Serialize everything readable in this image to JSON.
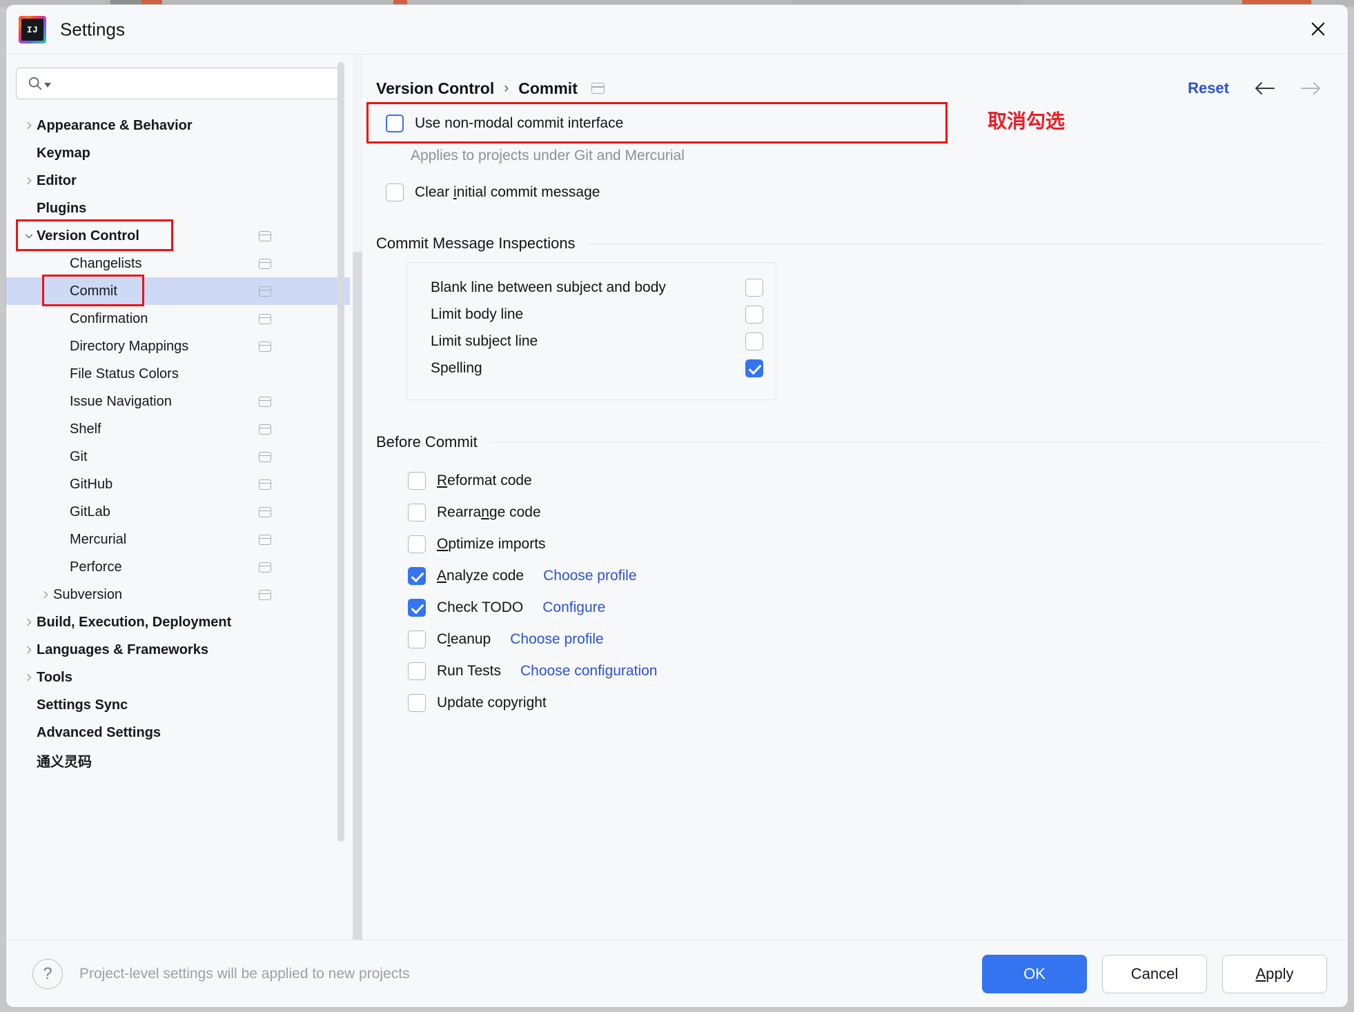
{
  "window": {
    "title": "Settings",
    "logo_text": "IJ",
    "close_icon": "close-icon"
  },
  "search": {
    "value": "",
    "placeholder": ""
  },
  "sidebar": {
    "items": [
      {
        "label": "Appearance & Behavior",
        "level": 1,
        "bold": true,
        "arrow": "right",
        "selected": false,
        "project_icon": false
      },
      {
        "label": "Keymap",
        "level": 1,
        "bold": true,
        "arrow": "none",
        "selected": false,
        "project_icon": false
      },
      {
        "label": "Editor",
        "level": 1,
        "bold": true,
        "arrow": "right",
        "selected": false,
        "project_icon": false
      },
      {
        "label": "Plugins",
        "level": 1,
        "bold": true,
        "arrow": "none",
        "selected": false,
        "project_icon": false
      },
      {
        "label": "Version Control",
        "level": 1,
        "bold": true,
        "arrow": "down",
        "selected": false,
        "project_icon": true
      },
      {
        "label": "Changelists",
        "level": 2,
        "bold": false,
        "arrow": "none",
        "selected": false,
        "project_icon": true
      },
      {
        "label": "Commit",
        "level": 2,
        "bold": false,
        "arrow": "none",
        "selected": true,
        "project_icon": true
      },
      {
        "label": "Confirmation",
        "level": 2,
        "bold": false,
        "arrow": "none",
        "selected": false,
        "project_icon": true
      },
      {
        "label": "Directory Mappings",
        "level": 2,
        "bold": false,
        "arrow": "none",
        "selected": false,
        "project_icon": true
      },
      {
        "label": "File Status Colors",
        "level": 2,
        "bold": false,
        "arrow": "none",
        "selected": false,
        "project_icon": false
      },
      {
        "label": "Issue Navigation",
        "level": 2,
        "bold": false,
        "arrow": "none",
        "selected": false,
        "project_icon": true
      },
      {
        "label": "Shelf",
        "level": 2,
        "bold": false,
        "arrow": "none",
        "selected": false,
        "project_icon": true
      },
      {
        "label": "Git",
        "level": 2,
        "bold": false,
        "arrow": "none",
        "selected": false,
        "project_icon": true
      },
      {
        "label": "GitHub",
        "level": 2,
        "bold": false,
        "arrow": "none",
        "selected": false,
        "project_icon": true
      },
      {
        "label": "GitLab",
        "level": 2,
        "bold": false,
        "arrow": "none",
        "selected": false,
        "project_icon": true
      },
      {
        "label": "Mercurial",
        "level": 2,
        "bold": false,
        "arrow": "none",
        "selected": false,
        "project_icon": true
      },
      {
        "label": "Perforce",
        "level": 2,
        "bold": false,
        "arrow": "none",
        "selected": false,
        "project_icon": true
      },
      {
        "label": "Subversion",
        "level": 2,
        "bold": false,
        "arrow": "right",
        "selected": false,
        "project_icon": true
      },
      {
        "label": "Build, Execution, Deployment",
        "level": 1,
        "bold": true,
        "arrow": "right",
        "selected": false,
        "project_icon": false
      },
      {
        "label": "Languages & Frameworks",
        "level": 1,
        "bold": true,
        "arrow": "right",
        "selected": false,
        "project_icon": false
      },
      {
        "label": "Tools",
        "level": 1,
        "bold": true,
        "arrow": "right",
        "selected": false,
        "project_icon": false
      },
      {
        "label": "Settings Sync",
        "level": 1,
        "bold": true,
        "arrow": "none",
        "selected": false,
        "project_icon": false
      },
      {
        "label": "Advanced Settings",
        "level": 1,
        "bold": true,
        "arrow": "none",
        "selected": false,
        "project_icon": false
      },
      {
        "label": "通义灵码",
        "level": 1,
        "bold": true,
        "arrow": "none",
        "selected": false,
        "project_icon": false
      }
    ]
  },
  "content": {
    "breadcrumb": {
      "parent": "Version Control",
      "separator": "›",
      "current": "Commit"
    },
    "reset_label": "Reset",
    "nav_back_icon": "arrow-left-icon",
    "nav_forward_icon": "arrow-right-icon",
    "non_modal": {
      "label": "Use non-modal commit interface",
      "checked": false,
      "focused": true,
      "note": "Applies to projects under Git and Mercurial",
      "annotation": "取消勾选",
      "annotation_color": "#ec1c24"
    },
    "clear_initial": {
      "label_before": "Clear ",
      "label_mnemonic": "i",
      "label_after": "nitial commit message",
      "checked": false
    },
    "inspections": {
      "title": "Commit Message Inspections",
      "rows": [
        {
          "name": "Blank line between subject and body",
          "checked": false
        },
        {
          "name": "Limit body line",
          "checked": false
        },
        {
          "name": "Limit subject line",
          "checked": false
        },
        {
          "name": "Spelling",
          "checked": true
        }
      ]
    },
    "before_commit": {
      "title": "Before Commit",
      "rows": [
        {
          "before": "",
          "mnemonic": "R",
          "after": "eformat code",
          "checked": false,
          "link": ""
        },
        {
          "before": "Rearra",
          "mnemonic": "n",
          "after": "ge code",
          "checked": false,
          "link": ""
        },
        {
          "before": "",
          "mnemonic": "O",
          "after": "ptimize imports",
          "checked": false,
          "link": ""
        },
        {
          "before": "",
          "mnemonic": "A",
          "after": "nalyze code",
          "checked": true,
          "link": "Choose profile"
        },
        {
          "before": "Check TODO",
          "mnemonic": "",
          "after": "",
          "checked": true,
          "link": "Configure"
        },
        {
          "before": "C",
          "mnemonic": "l",
          "after": "eanup",
          "checked": false,
          "link": "Choose profile"
        },
        {
          "before": "Run Tests",
          "mnemonic": "",
          "after": "",
          "checked": false,
          "link": "Choose configuration"
        },
        {
          "before": "Update copyright",
          "mnemonic": "",
          "after": "",
          "checked": false,
          "link": ""
        }
      ]
    }
  },
  "footer": {
    "help_icon": "question-mark-icon",
    "note": "Project-level settings will be applied to new projects",
    "buttons": {
      "ok": "OK",
      "cancel": "Cancel",
      "apply_mnemonic": "A",
      "apply_rest": "pply"
    }
  },
  "colors": {
    "accent": "#3574f0",
    "link": "#2b52d4",
    "annotation_red": "#ec1c24",
    "highlight_red": "#ee1111",
    "selection": "#cdd9f5"
  }
}
